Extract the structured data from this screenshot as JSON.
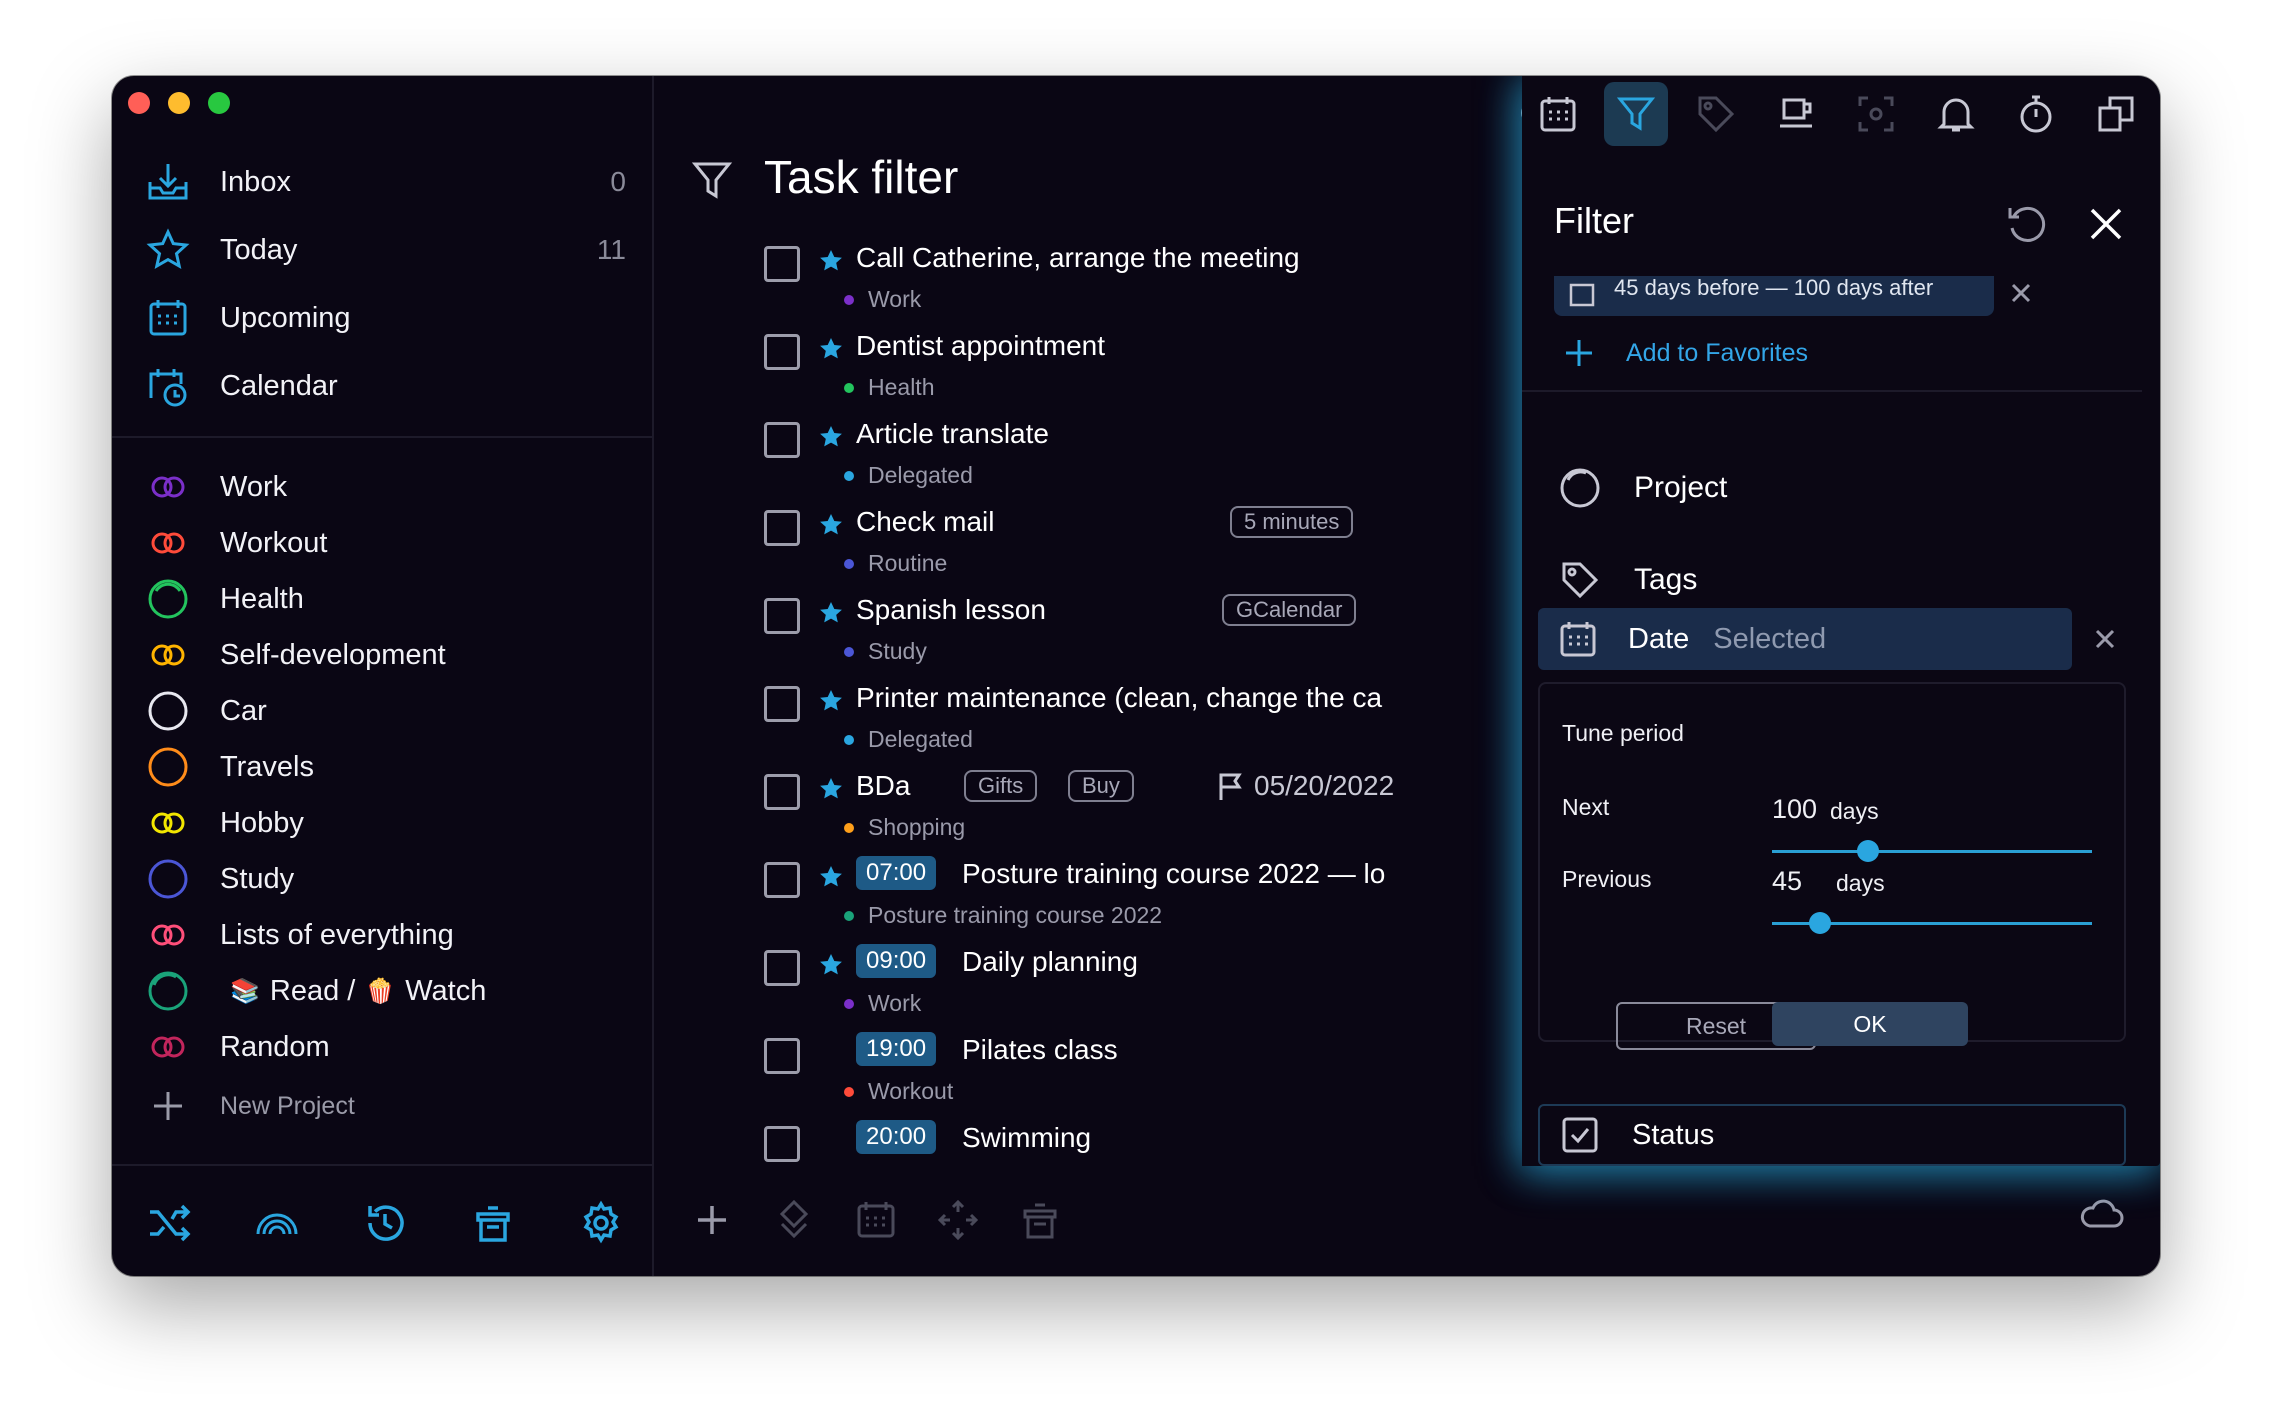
{
  "sidebar": {
    "nav": [
      {
        "label": "Inbox",
        "count": "0",
        "icon": "inbox-icon"
      },
      {
        "label": "Today",
        "count": "11",
        "icon": "star-icon"
      },
      {
        "label": "Upcoming",
        "count": "",
        "icon": "calendar-grid-icon"
      },
      {
        "label": "Calendar",
        "count": "",
        "icon": "calendar-clock-icon"
      }
    ],
    "projects": [
      {
        "label": "Work",
        "color": "#7b2fc9",
        "icon": "double-ring-icon"
      },
      {
        "label": "Workout",
        "color": "#ff4b3a",
        "icon": "double-ring-icon"
      },
      {
        "label": "Health",
        "color": "#23c45e",
        "icon": "ring-icon"
      },
      {
        "label": "Self-development",
        "color": "#ffb400",
        "icon": "double-ring-icon"
      },
      {
        "label": "Car",
        "color": "#e8e8f0",
        "icon": "ring-icon"
      },
      {
        "label": "Travels",
        "color": "#ff8c1a",
        "icon": "ring-icon"
      },
      {
        "label": "Hobby",
        "color": "#f2e600",
        "icon": "double-ring-icon"
      },
      {
        "label": "Study",
        "color": "#4b56d6",
        "icon": "ring-icon"
      },
      {
        "label": "Lists of everything",
        "color": "#ff4f7a",
        "icon": "double-ring-icon"
      },
      {
        "label": "Read /",
        "label2": "Watch",
        "color": "#1aa37a",
        "icon": "ring-icon"
      },
      {
        "label": "Random",
        "color": "#c2255c",
        "icon": "double-ring-icon"
      }
    ],
    "new_project": "New Project"
  },
  "main": {
    "title": "Task filter",
    "tasks": [
      {
        "name": "Call Catherine, arrange the meeting",
        "project": "Work",
        "dot": "#7b2fc9",
        "prio": "star"
      },
      {
        "name": "Dentist appointment",
        "project": "Health",
        "dot": "#23c45e",
        "prio": "star"
      },
      {
        "name": "Article translate",
        "project": "Delegated",
        "dot": "#2aa6e0",
        "prio": "star"
      },
      {
        "name": "Check mail",
        "project": "Routine",
        "dot": "#4b56d6",
        "prio": "star",
        "chip": "5 minutes"
      },
      {
        "name": "Spanish lesson",
        "project": "Study",
        "dot": "#4b56d6",
        "prio": "star",
        "chip": "GCalendar"
      },
      {
        "name": "Printer maintenance (clean, change the ca",
        "project": "Delegated",
        "dot": "#2aa6e0",
        "prio": "star"
      },
      {
        "name": "BDa",
        "project": "Shopping",
        "dot": "#ff9f1a",
        "prio": "star",
        "chips": [
          "Gifts",
          "Buy"
        ],
        "date": "05/20/2022"
      },
      {
        "name": "Posture training course 2022 — lo",
        "project": "Posture training course 2022",
        "dot": "#1aa37a",
        "prio": "star",
        "time": "07:00"
      },
      {
        "name": "Daily planning",
        "project": "Work",
        "dot": "#7b2fc9",
        "prio": "star",
        "time": "09:00"
      },
      {
        "name": "Pilates class",
        "project": "Workout",
        "dot": "#ff4b3a",
        "prio": "moon",
        "time": "19:00"
      },
      {
        "name": "Swimming",
        "project": "",
        "dot": "#7b2fc9",
        "prio": "moon",
        "time": "20:00"
      }
    ]
  },
  "filter": {
    "title": "Filter",
    "active_range": "45 days before — 100 days after",
    "add_favorites": "Add to Favorites",
    "project": "Project",
    "tags": "Tags",
    "date": "Date",
    "date_state": "Selected",
    "tune_period": "Tune period",
    "next_label": "Next",
    "next_value": "100",
    "next_unit": "days",
    "next_fraction": 0.3,
    "previous_label": "Previous",
    "previous_value": "45",
    "previous_unit": "days",
    "previous_fraction": 0.15,
    "reset": "Reset",
    "ok": "OK",
    "status": "Status"
  },
  "colors": {
    "accent": "#2aa6e0",
    "background": "#0a0614"
  }
}
